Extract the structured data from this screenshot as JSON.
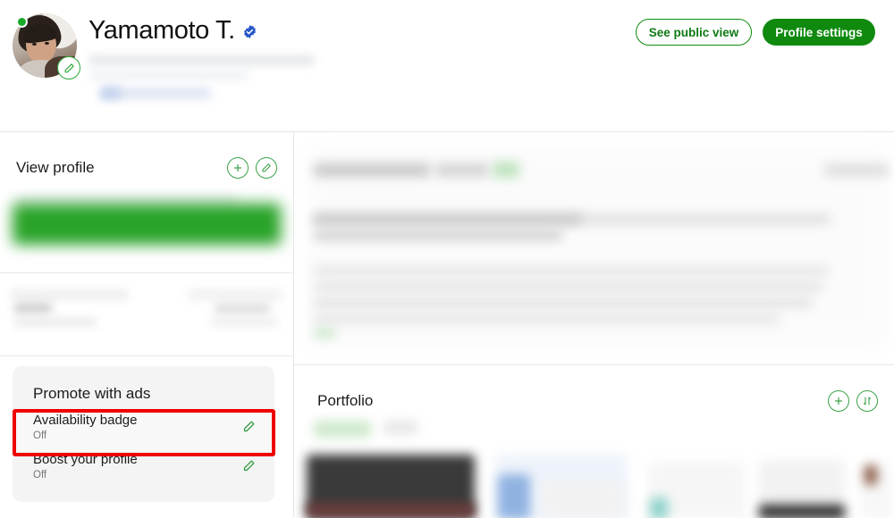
{
  "header": {
    "profile_name": "Yamamoto T.",
    "verified_icon": "verified-badge-icon",
    "status_icon": "online-status-dot",
    "avatar_edit_icon": "pencil-edit-icon",
    "buttons": {
      "public_view": "See public view",
      "profile_settings": "Profile settings"
    },
    "accent_green": "#0f8a0f",
    "verified_blue": "#2557c7"
  },
  "sidebar": {
    "view_profile": {
      "title": "View profile",
      "add_icon": "plus-icon",
      "edit_icon": "pencil-edit-icon"
    },
    "promote": {
      "title": "Promote with ads",
      "items": [
        {
          "label": "Availability badge",
          "status": "Off",
          "edit_icon": "pencil-edit-icon",
          "highlighted": true
        },
        {
          "label": "Boost your profile",
          "status": "Off",
          "edit_icon": "pencil-edit-icon",
          "highlighted": false
        }
      ]
    },
    "highlight_color": "#ee0000"
  },
  "main": {
    "portfolio": {
      "title": "Portfolio",
      "add_icon": "plus-icon",
      "sort_icon": "sort-arrows-icon"
    }
  }
}
